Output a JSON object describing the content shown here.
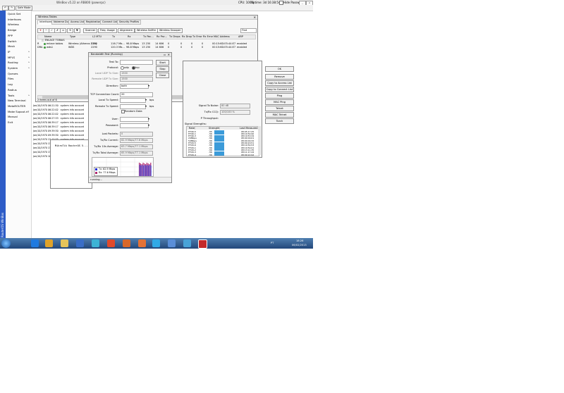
{
  "window": {
    "title": "WinBox v5.22 on RB800 (powerpc)",
    "cpu": "CPU: 100%",
    "uptime": "Uptime: 3d 16:38:54",
    "hide_passwords": "Hide Passwords"
  },
  "toolbar": {
    "safe_mode": "Safe Mode"
  },
  "sidebar_label": "RouterOS WinBox",
  "menu": [
    {
      "label": "Quick Set",
      "arrow": false
    },
    {
      "label": "Interfaces",
      "arrow": false
    },
    {
      "label": "Wireless",
      "arrow": false
    },
    {
      "label": "Bridge",
      "arrow": false
    },
    {
      "label": "PPP",
      "arrow": false
    },
    {
      "label": "Switch",
      "arrow": false
    },
    {
      "label": "Mesh",
      "arrow": false
    },
    {
      "label": "IP",
      "arrow": true
    },
    {
      "label": "MPLS",
      "arrow": true
    },
    {
      "label": "Routing",
      "arrow": true
    },
    {
      "label": "System",
      "arrow": true
    },
    {
      "label": "Queues",
      "arrow": false
    },
    {
      "label": "Files",
      "arrow": false
    },
    {
      "label": "Log",
      "arrow": false
    },
    {
      "label": "Radius",
      "arrow": false
    },
    {
      "label": "Tools",
      "arrow": true
    },
    {
      "label": "New Terminal",
      "arrow": false
    },
    {
      "label": "MetaROUTER",
      "arrow": false
    },
    {
      "label": "Make Supout.rif",
      "arrow": false
    },
    {
      "label": "Manual",
      "arrow": false
    },
    {
      "label": "Exit",
      "arrow": false
    }
  ],
  "wireless_tables": {
    "title": "Wireless Tables",
    "tabs": [
      "Interfaces",
      "Nstreme Dual",
      "Access List",
      "Registration",
      "Connect List",
      "Security Profiles"
    ],
    "buttons": [
      "Scanner",
      "Freq. Usage",
      "Alignment",
      "Wireless Sniffer",
      "Wireless Snooper"
    ],
    "find": "Find",
    "columns": [
      "Name",
      "Type",
      "L2 MTU",
      "Tx",
      "Rx",
      "Tx Pac...",
      "Rx Pac...",
      "Tx Drops",
      "Rx Drops",
      "Tx Errors",
      "Rx Errors",
      "MAC Address",
      "ARP"
    ],
    "comment": ";;; ENLACE TOBIAS",
    "rows": [
      {
        "flag": "R",
        "name": "enlace tobias",
        "type": "Wireless (Atheros 11N)",
        "l2mtu": "2290",
        "tx": "116.7 Mb...",
        "rx": "98.8 Mbps",
        "txp": "13 230",
        "rxp": "14 606",
        "txd": "0",
        "rxd": "0",
        "txe": "0",
        "rxe": "0",
        "mac": "00:15:6D:E5:44:E7",
        "arp": "enabled"
      },
      {
        "flag": "DRA",
        "name": "wds1",
        "type": "WDS",
        "l2mtu": "2290",
        "tx": "120.3 Mb...",
        "rx": "98.8 Mbps",
        "txp": "13 230",
        "rxp": "14 606",
        "txd": "0",
        "rxd": "0",
        "txe": "0",
        "rxe": "0",
        "mac": "00:15:6D:E5:44:E7",
        "arp": "enabled"
      }
    ],
    "status": "2 items out of 6"
  },
  "log_rows": [
    {
      "time": "Jan/10/1970 06:21:30",
      "topic": "system info account"
    },
    {
      "time": "Jan/10/1970 06:22:02",
      "topic": "system info account"
    },
    {
      "time": "Jan/10/1970 06:22:02",
      "topic": "system info account"
    },
    {
      "time": "Jan/10/1970 06:27:33",
      "topic": "system info account"
    },
    {
      "time": "Jan/10/1970 06:39:17",
      "topic": "system info account"
    },
    {
      "time": "Jan/10/1970 06:39:17",
      "topic": "system info account"
    },
    {
      "time": "Jan/10/1970 09:39:30",
      "topic": "system info account"
    },
    {
      "time": "Jan/10/1970 09:39:30",
      "topic": "system info account"
    },
    {
      "time": "Jan/10/1970 15:10:35",
      "topic": "system info account"
    },
    {
      "time": "Jan/10/1970 15:10:35",
      "topic": "system info account"
    },
    {
      "time": "Jan/10/1970 15:10:52",
      "topic": "system info account"
    },
    {
      "time": "Jan/10/1970 15:10:52",
      "topic": "system info account"
    },
    {
      "time": "Jan/10/1970 16:35:21",
      "topic": "system info account"
    }
  ],
  "terminal_text": "MikroTik RouterOS 5...",
  "bandwidth_test": {
    "title": "Bandwidth Test (Running)",
    "test_to_label": "Test To:",
    "protocol_label": "Protocol:",
    "udp": "udp",
    "tcp": "tcp",
    "local_udp_label": "Local UDP Tx Size:",
    "local_udp_value": "1500",
    "remote_udp_label": "Remote UDP Tx Size:",
    "remote_udp_value": "1500",
    "direction_label": "Direction:",
    "direction_value": "both",
    "tcp_count_label": "TCP Connection Count:",
    "tcp_count_value": "20",
    "local_speed_label": "Local Tx Speed:",
    "remote_speed_label": "Remote Tx Speed:",
    "bps": "bps",
    "random_data": "Random Data",
    "user_label": "User:",
    "password_label": "Password:",
    "lost_label": "Lost Packets:",
    "lost_value": "0",
    "current_label": "Tx/Rx Current:",
    "current_value": "62.9 Mbps/77.6 Mbps",
    "avg10_label": "Tx/Rx 10s Average:",
    "avg10_value": "63.7 Mbps/77.1 Mbps",
    "total_label": "Tx/Rx Total Average:",
    "total_value": "65.9 Mbps/77.1 Mbps",
    "legend_tx": "Tx: 62.9 Mbps",
    "legend_rx": "Rx: 77.6 Mbps",
    "status": "running...",
    "start": "Start",
    "stop": "Stop",
    "close": "Close",
    "colors": {
      "tx": "#1a2ad6",
      "rx": "#b0286e"
    }
  },
  "registration": {
    "buttons": [
      "OK",
      "Remove",
      "Copy to Access List",
      "Copy to Connect List",
      "Ping",
      "MAC Ping",
      "Telnet",
      "MAC Telnet",
      "Torch"
    ],
    "signal_to_noise_label": "Signal To Noise:",
    "signal_to_noise_value": "80 dB",
    "ccq_label": "Tx/Rx CCQ:",
    "ccq_value": "100/100 %",
    "throughput_label": "P Throughput:",
    "strengths_title": "Signal Strengths:",
    "columns": [
      "Rate",
      "Strength",
      "Last Measured"
    ],
    "rows": [
      {
        "rate": "HT40-5",
        "strength": "-55",
        "level": 0.9,
        "time": "08:05:17.25"
      },
      {
        "rate": "HT40-1",
        "strength": "-56",
        "level": 0.88,
        "time": "08:19:54.90"
      },
      {
        "rate": "HT40-3",
        "strength": "-56",
        "level": 0.88,
        "time": "08:19:53.34"
      },
      {
        "rate": "24Mbps",
        "strength": "-56",
        "level": 0.88,
        "time": "08:00:00.01"
      },
      {
        "rate": "54Mbps",
        "strength": "-56",
        "level": 0.88,
        "time": "08:00:00.32"
      },
      {
        "rate": "HT20-5",
        "strength": "-56",
        "level": 0.88,
        "time": "08:09:20.51"
      },
      {
        "rate": "HT20-6",
        "strength": "-56",
        "level": 0.88,
        "time": "08:19:54.53"
      },
      {
        "rate": "HT20-1",
        "strength": "-56",
        "level": 0.88,
        "time": "08:19:54.01"
      },
      {
        "rate": "HT20-2",
        "strength": "-56",
        "level": 0.88,
        "time": "08:13:11.35"
      },
      {
        "rate": "HT20-3",
        "strength": "-56",
        "level": 0.88,
        "time": "08:11:17.44"
      },
      {
        "rate": "HT20-4",
        "strength": "-56",
        "level": 0.88,
        "time": "08:09:22.92"
      }
    ]
  },
  "taskbar": {
    "language": "PT",
    "time": "18:26",
    "date": "06/02/2013"
  }
}
